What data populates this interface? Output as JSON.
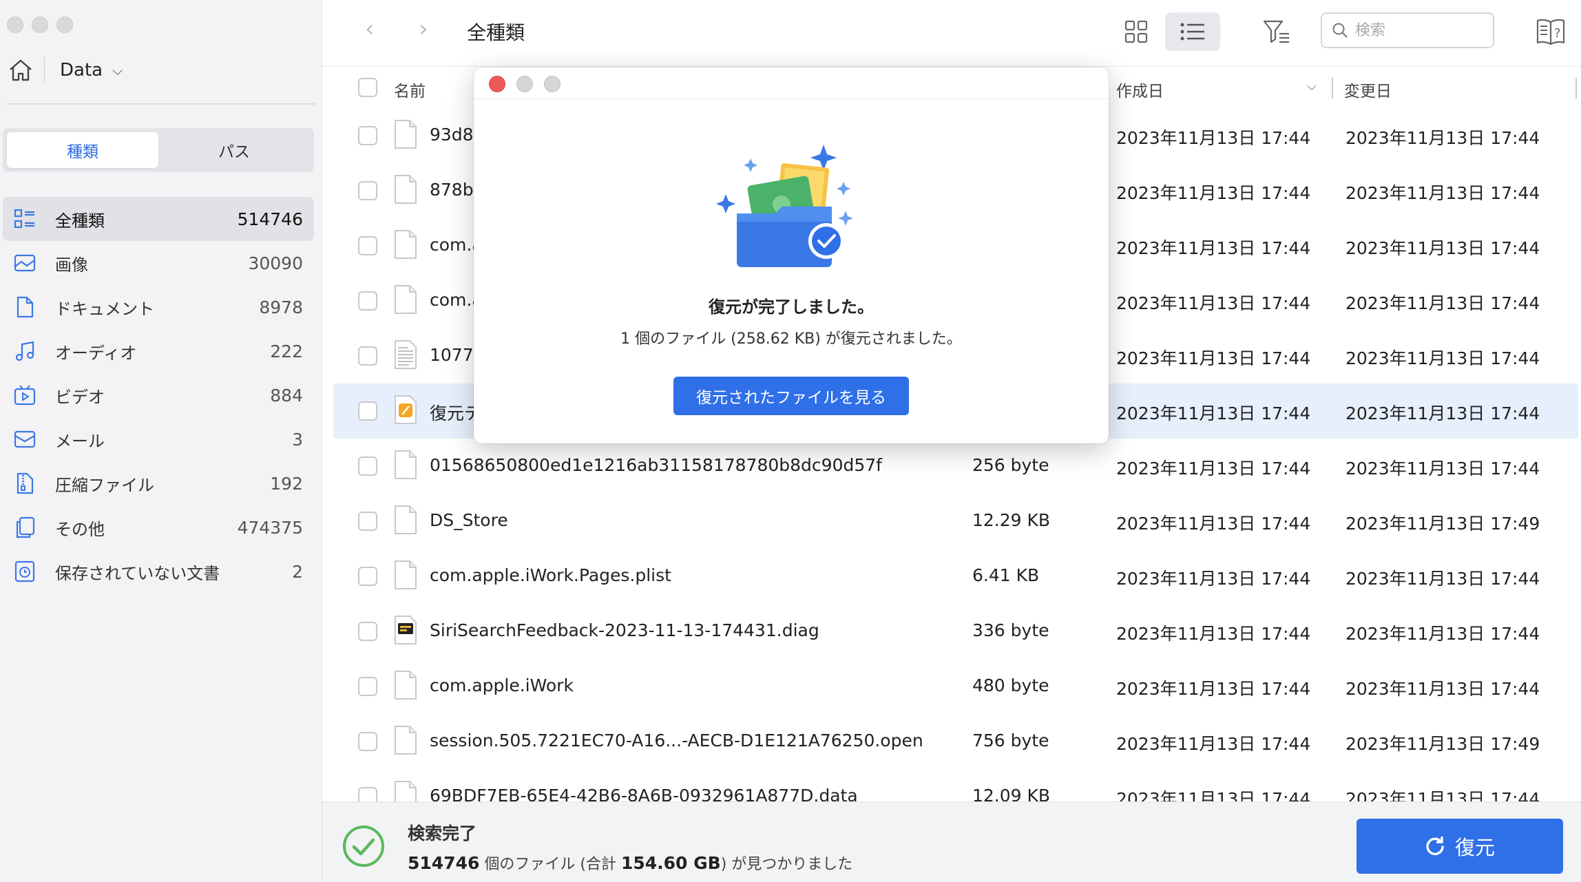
{
  "sidebar": {
    "drive_name": "Data",
    "segments": [
      {
        "label": "種類",
        "active": true
      },
      {
        "label": "パス",
        "active": false
      }
    ],
    "categories": [
      {
        "label": "全種類",
        "count": "514746",
        "icon": "grid-list-icon",
        "active": true
      },
      {
        "label": "画像",
        "count": "30090",
        "icon": "image-icon"
      },
      {
        "label": "ドキュメント",
        "count": "8978",
        "icon": "document-icon"
      },
      {
        "label": "オーディオ",
        "count": "222",
        "icon": "music-note-icon"
      },
      {
        "label": "ビデオ",
        "count": "884",
        "icon": "video-icon"
      },
      {
        "label": "メール",
        "count": "3",
        "icon": "mail-icon"
      },
      {
        "label": "圧縮ファイル",
        "count": "192",
        "icon": "archive-icon"
      },
      {
        "label": "その他",
        "count": "474375",
        "icon": "copy-files-icon"
      },
      {
        "label": "保存されていない文書",
        "count": "2",
        "icon": "clock-document-icon"
      }
    ]
  },
  "toolbar": {
    "title": "全種類",
    "search_placeholder": "検索"
  },
  "table": {
    "headers": {
      "name": "名前",
      "created": "作成日",
      "modified": "変更日"
    },
    "rows": [
      {
        "name": "93d8",
        "size": "",
        "created": "2023年11月13日 17:44",
        "modified": "2023年11月13日 17:44",
        "icon": "file"
      },
      {
        "name": "878b(",
        "size": "",
        "created": "2023年11月13日 17:44",
        "modified": "2023年11月13日 17:44",
        "icon": "file"
      },
      {
        "name": "com.a",
        "size": "",
        "created": "2023年11月13日 17:44",
        "modified": "2023年11月13日 17:44",
        "icon": "file"
      },
      {
        "name": "com.a",
        "size": "",
        "created": "2023年11月13日 17:44",
        "modified": "2023年11月13日 17:44",
        "icon": "file"
      },
      {
        "name": "10772",
        "size": "",
        "created": "2023年11月13日 17:44",
        "modified": "2023年11月13日 17:44",
        "icon": "text-file"
      },
      {
        "name": "復元テ",
        "size": "",
        "created": "2023年11月13日 17:44",
        "modified": "2023年11月13日 17:44",
        "icon": "pages",
        "selected": true
      },
      {
        "name": "01568650800ed1e1216ab31158178780b8dc90d57f",
        "size": "256 byte",
        "created": "2023年11月13日 17:44",
        "modified": "2023年11月13日 17:44",
        "icon": "file"
      },
      {
        "name": "DS_Store",
        "size": "12.29 KB",
        "created": "2023年11月13日 17:44",
        "modified": "2023年11月13日 17:49",
        "icon": "file"
      },
      {
        "name": "com.apple.iWork.Pages.plist",
        "size": "6.41 KB",
        "created": "2023年11月13日 17:44",
        "modified": "2023年11月13日 17:44",
        "icon": "file"
      },
      {
        "name": "SiriSearchFeedback-2023-11-13-174431.diag",
        "size": "336 byte",
        "created": "2023年11月13日 17:44",
        "modified": "2023年11月13日 17:44",
        "icon": "diag"
      },
      {
        "name": "com.apple.iWork",
        "size": "480 byte",
        "created": "2023年11月13日 17:44",
        "modified": "2023年11月13日 17:44",
        "icon": "file"
      },
      {
        "name": "session.505.7221EC70-A16...-AECB-D1E121A76250.open",
        "size": "756 byte",
        "created": "2023年11月13日 17:44",
        "modified": "2023年11月13日 17:49",
        "icon": "file"
      },
      {
        "name": "69BDF7EB-65E4-42B6-8A6B-0932961A877D.data",
        "size": "12.09 KB",
        "created": "2023年11月13日 17:44",
        "modified": "2023年11月13日 17:44",
        "icon": "file"
      }
    ]
  },
  "status": {
    "title": "検索完了",
    "count": "514746",
    "text_mid": " 個のファイル (合計 ",
    "total": "154.60 GB",
    "text_end": ") が見つかりました",
    "recover_label": "復元"
  },
  "dialog": {
    "title": "復元が完了しました。",
    "message": "1 個のファイル (258.62 KB) が復元されました。",
    "button_label": "復元されたファイルを見る"
  },
  "colors": {
    "accent": "#2f6fe8",
    "selected_row": "#e7effc",
    "success": "#5cb85c"
  }
}
